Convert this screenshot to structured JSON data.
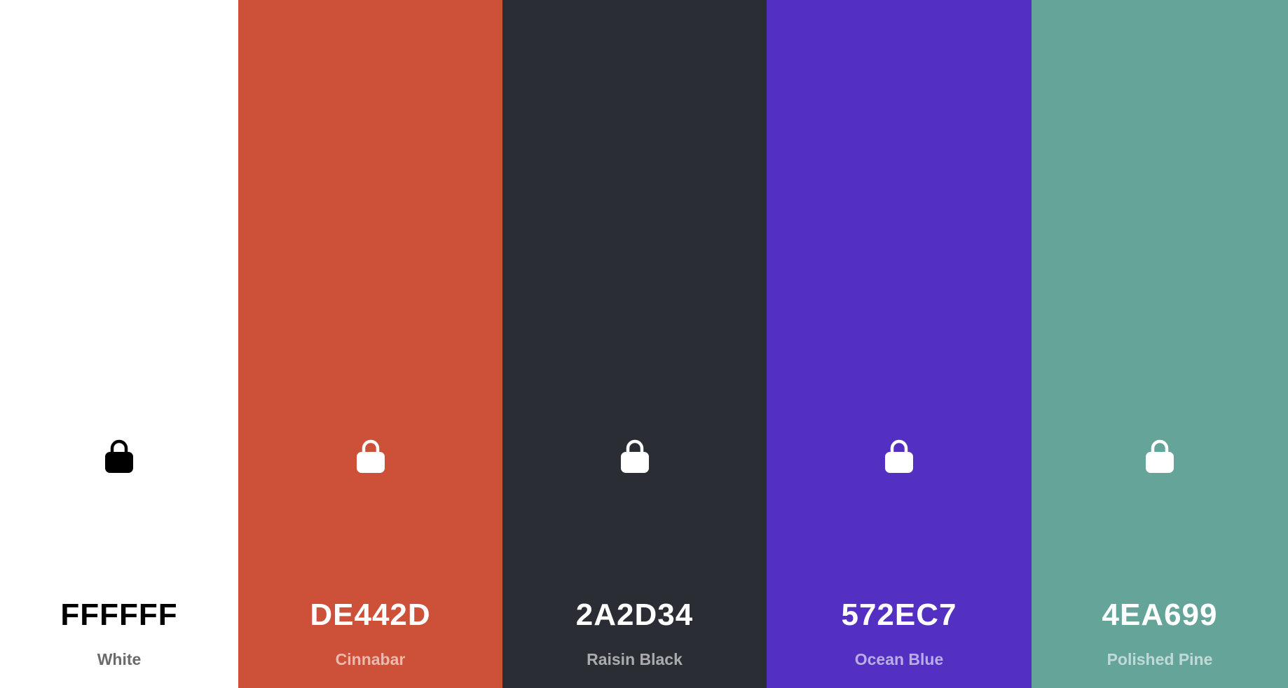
{
  "swatches": [
    {
      "hex": "FFFFFF",
      "name": "White",
      "color": "#FFFFFF",
      "icon": "lock-icon",
      "tone": "light"
    },
    {
      "hex": "DE442D",
      "name": "Cinnabar",
      "color": "#CD5138",
      "icon": "lock-icon",
      "tone": "dark"
    },
    {
      "hex": "2A2D34",
      "name": "Raisin Black",
      "color": "#2A2D34",
      "icon": "lock-icon",
      "tone": "dark"
    },
    {
      "hex": "572EC7",
      "name": "Ocean Blue",
      "color": "#5330C2",
      "icon": "lock-icon",
      "tone": "dark"
    },
    {
      "hex": "4EA699",
      "name": "Polished Pine",
      "color": "#65A499",
      "icon": "lock-icon",
      "tone": "dark"
    }
  ]
}
